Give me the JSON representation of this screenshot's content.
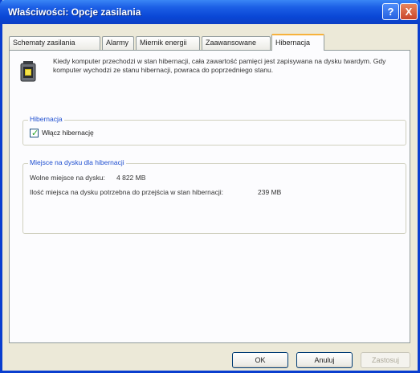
{
  "window": {
    "title": "Właściwości: Opcje zasilania",
    "help_glyph": "?",
    "close_glyph": "X"
  },
  "tabs": [
    {
      "label": "Schematy zasilania"
    },
    {
      "label": "Alarmy"
    },
    {
      "label": "Miernik energii"
    },
    {
      "label": "Zaawansowane"
    },
    {
      "label": "Hibernacja",
      "active": true
    }
  ],
  "intro": {
    "icon": "battery-icon",
    "text": "Kiedy komputer przechodzi w stan hibernacji, cała zawartość pamięci jest zapisywana na dysku twardym. Gdy komputer wychodzi ze stanu hibernacji, powraca do poprzedniego stanu."
  },
  "hibernation_group": {
    "title": "Hibernacja",
    "checkbox_label": "Włącz hibernację",
    "checked": true
  },
  "disk_group": {
    "title": "Miejsce na dysku dla hibernacji",
    "free_space_label": "Wolne miejsce na dysku:",
    "free_space_value": "4 822 MB",
    "required_label": "Ilość miejsca na dysku potrzebna do przejścia w stan hibernacji:",
    "required_value": "239 MB"
  },
  "buttons": {
    "ok": "OK",
    "cancel": "Anuluj",
    "apply": "Zastosuj"
  }
}
